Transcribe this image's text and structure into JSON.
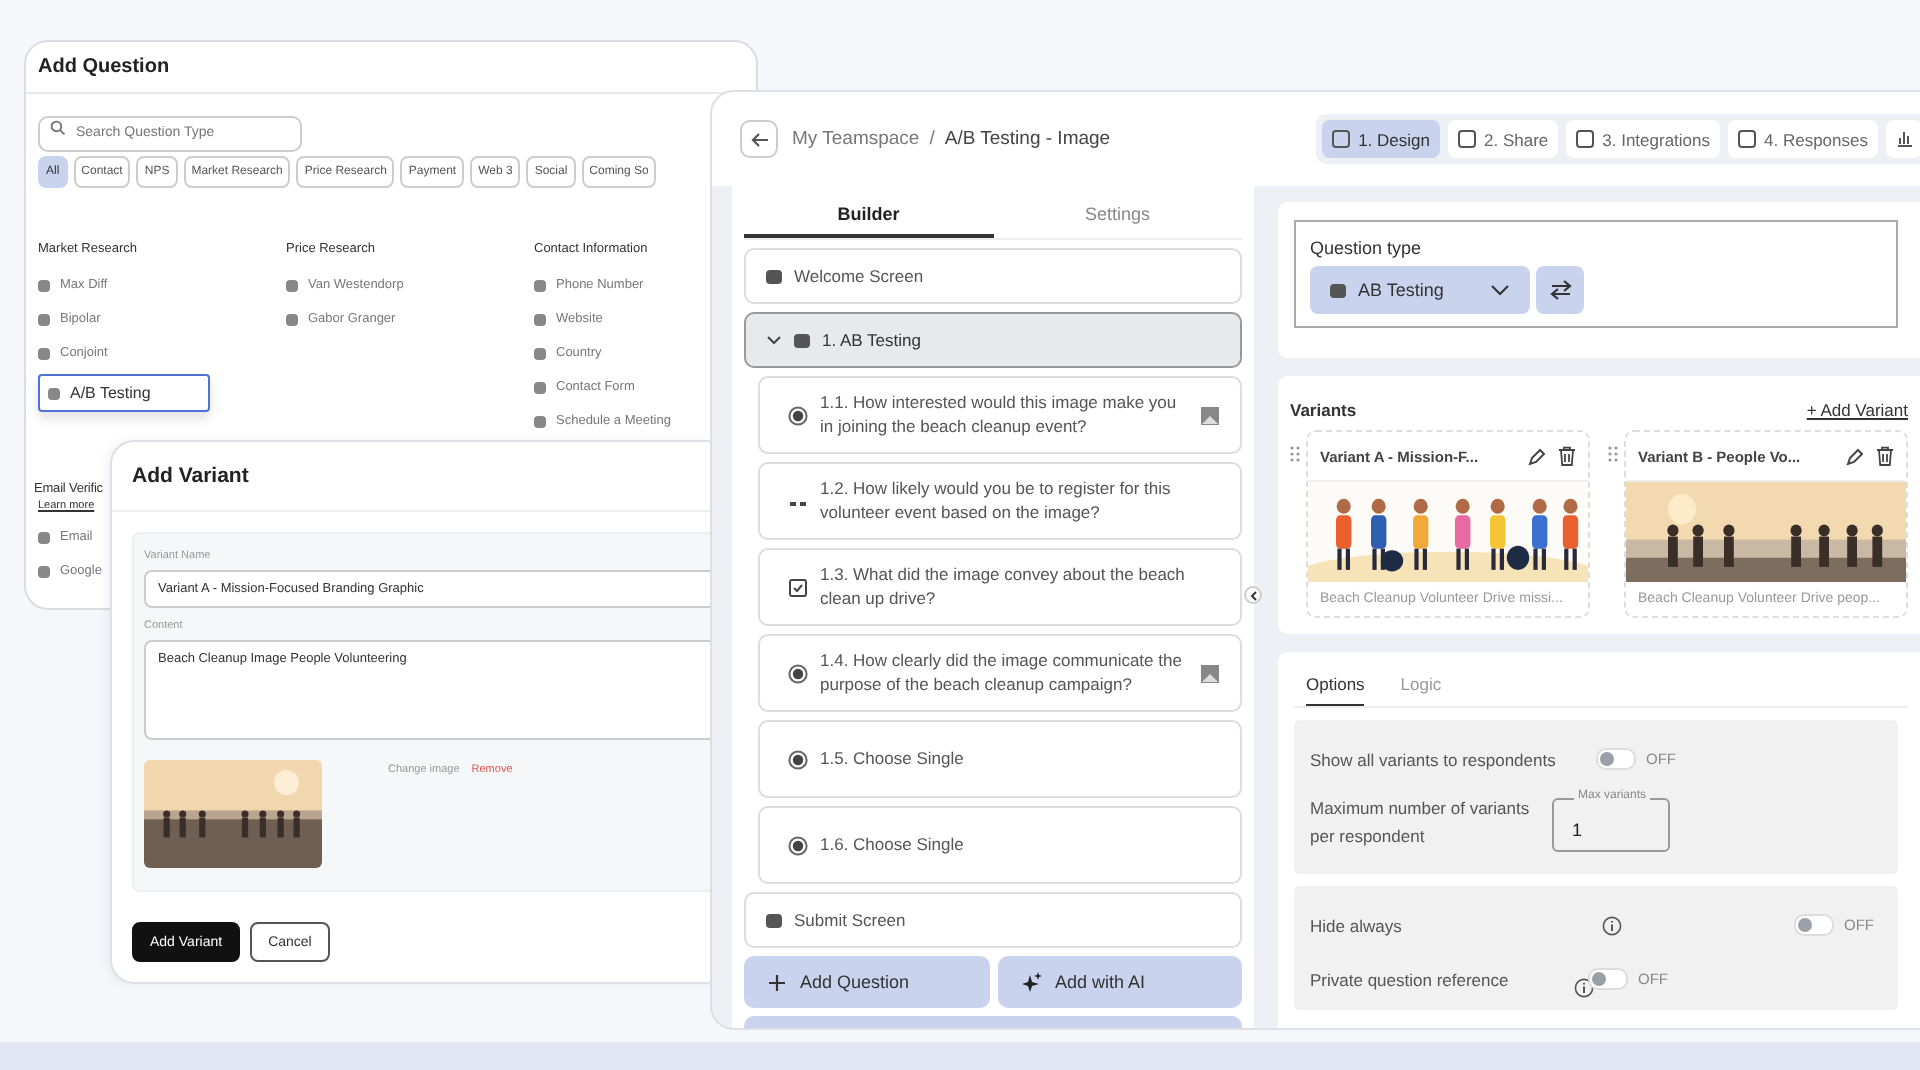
{
  "add_question": {
    "title": "Add Question",
    "search": {
      "placeholder": "Search Question Type"
    },
    "filters": [
      {
        "label": "All",
        "selected": true
      },
      {
        "label": "Contact",
        "selected": false
      },
      {
        "label": "NPS",
        "selected": false
      },
      {
        "label": "Market Research",
        "selected": false
      },
      {
        "label": "Price Research",
        "selected": false
      },
      {
        "label": "Payment",
        "selected": false
      },
      {
        "label": "Web 3",
        "selected": false
      },
      {
        "label": "Social",
        "selected": false
      },
      {
        "label": "Coming So",
        "selected": false
      }
    ],
    "categories": [
      {
        "title": "Market Research",
        "items": [
          {
            "label": "Max Diff",
            "selected": false
          },
          {
            "label": "Bipolar",
            "selected": false
          },
          {
            "label": "Conjoint",
            "selected": false
          },
          {
            "label": "A/B Testing",
            "selected": true
          }
        ]
      },
      {
        "title": "Price Research",
        "items": [
          {
            "label": "Van Westendorp",
            "selected": false
          },
          {
            "label": "Gabor Granger",
            "selected": false
          }
        ]
      },
      {
        "title": "Contact Information",
        "items": [
          {
            "label": "Phone Number",
            "selected": false
          },
          {
            "label": "Website",
            "selected": false
          },
          {
            "label": "Country",
            "selected": false
          },
          {
            "label": "Contact Form",
            "selected": false
          },
          {
            "label": "Schedule a Meeting",
            "selected": false
          }
        ]
      }
    ],
    "email_section": {
      "title": "Email Verific",
      "link": "Learn more",
      "items": [
        "Email",
        "Google"
      ]
    }
  },
  "add_variant": {
    "title": "Add Variant",
    "name_field": {
      "label": "Variant Name",
      "value": "Variant A - Mission-Focused Branding Graphic"
    },
    "content_field": {
      "label": "Content",
      "value": "Beach Cleanup Image People Volunteering"
    },
    "change_link": "Change image",
    "remove_link": "Remove",
    "buttons": [
      {
        "label": "Add Variant",
        "kind": "primary"
      },
      {
        "label": "Cancel",
        "kind": "secondary"
      }
    ]
  },
  "app": {
    "breadcrumb": [
      "My Teamspace",
      "A/B Testing - Image"
    ],
    "breadcrumb_separator": "/",
    "steps": [
      {
        "label": "1. Design",
        "selected": true
      },
      {
        "label": "2. Share",
        "selected": false
      },
      {
        "label": "3. Integrations",
        "selected": false
      },
      {
        "label": "4. Responses",
        "selected": false
      }
    ],
    "panel_tabs": [
      {
        "label": "Builder",
        "selected": true
      },
      {
        "label": "Settings",
        "selected": false
      }
    ],
    "welcome": "Welcome Screen",
    "group": {
      "label": "1. AB Testing",
      "expanded": true,
      "selected": true,
      "children": [
        {
          "label": "1.1. How interested would this image make you in joining the beach cleanup event?",
          "kind": "single",
          "has_image": true
        },
        {
          "label": "1.2. How likely would you be to register for this volunteer event based on the image?",
          "kind": "dots",
          "has_image": false
        },
        {
          "label": "1.3. What did the image convey about the beach clean up drive?",
          "kind": "checkbox",
          "has_image": false
        },
        {
          "label": "1.4. How clearly did the image communicate the purpose of the beach cleanup campaign?",
          "kind": "single",
          "has_image": true
        },
        {
          "label": "1.5. Choose Single",
          "kind": "single",
          "has_image": false
        },
        {
          "label": "1.6. Choose Single",
          "kind": "single",
          "has_image": false
        }
      ]
    },
    "submit": "Submit Screen",
    "actions": [
      {
        "label": "Add Question",
        "kind": "plus"
      },
      {
        "label": "Add with AI",
        "kind": "ai"
      }
    ],
    "question_type": {
      "label": "Question type",
      "value": "AB Testing"
    },
    "variants": {
      "title": "Variants",
      "add_label": "+ Add Variant",
      "items": [
        {
          "name": "Variant A - Mission-F...",
          "caption": "Beach Cleanup Volunteer Drive missi..."
        },
        {
          "name": "Variant B - People Vo...",
          "caption": "Beach Cleanup Volunteer Drive peop..."
        }
      ]
    },
    "option_tabs": [
      {
        "label": "Options",
        "selected": true
      },
      {
        "label": "Logic",
        "selected": false
      }
    ],
    "show_all": {
      "label": "Show all variants to respondents",
      "on": false,
      "state_text": "OFF"
    },
    "max_variants": {
      "label": "Maximum number of variants per respondent",
      "field_label": "Max variants",
      "value": "1"
    },
    "hide_always": {
      "label": "Hide always",
      "on": false,
      "state_text": "OFF"
    },
    "private_ref": {
      "label": "Private question reference",
      "on": false,
      "state_text": "OFF"
    }
  }
}
